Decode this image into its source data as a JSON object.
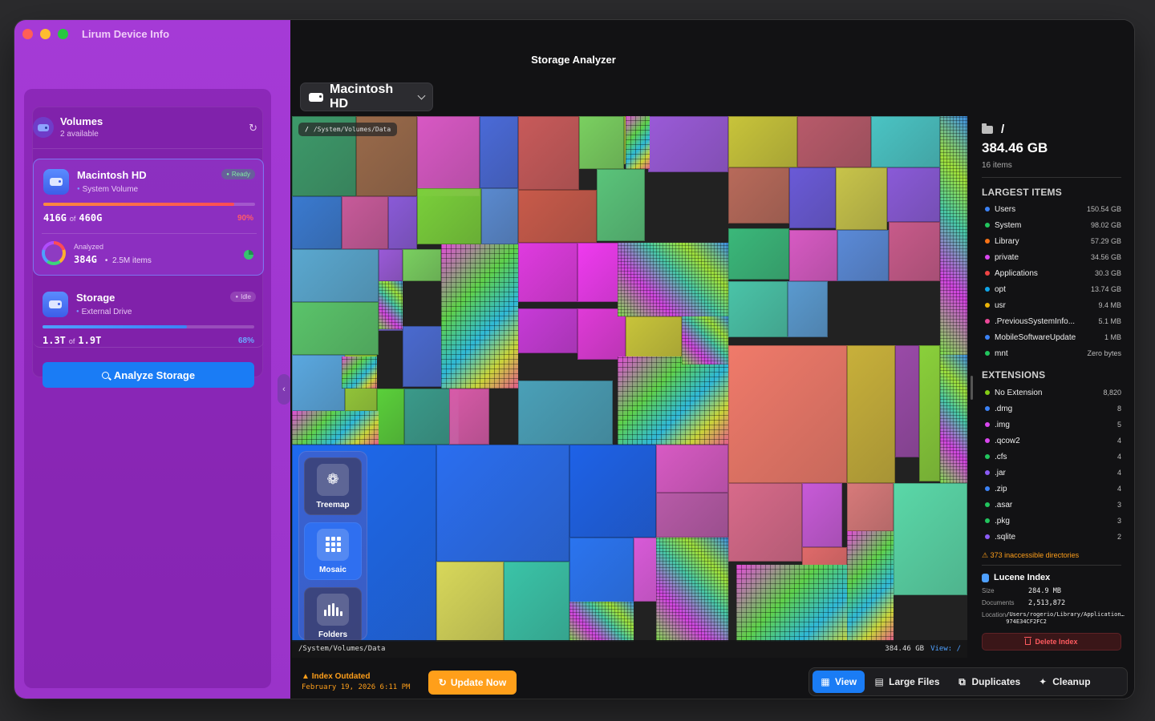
{
  "app": {
    "title": "Lirum Device Info"
  },
  "volumes": {
    "title": "Volumes",
    "subtitle": "2 available",
    "drives": [
      {
        "name": "Macintosh HD",
        "type": "System Volume",
        "status": "Ready",
        "used": "416G",
        "of": "of",
        "total": "460G",
        "percent": "90%",
        "fill_fraction": 0.9,
        "analyzed_label": "Analyzed",
        "analyzed_size": "384G",
        "analyzed_items": "2.5M items"
      },
      {
        "name": "Storage",
        "type": "External Drive",
        "status": "Idle",
        "used": "1.3T",
        "of": "of",
        "total": "1.9T",
        "percent": "68%",
        "fill_fraction": 0.68
      }
    ],
    "analyze_button": "Analyze Storage"
  },
  "main": {
    "title": "Storage Analyzer",
    "selected_volume": "Macintosh HD"
  },
  "treemap": {
    "path_root": "/",
    "path": "/System/Volumes/Data",
    "footer_path": "/System/Volumes/Data",
    "footer_size": "384.46 GB",
    "footer_view": "View: /",
    "modes": [
      {
        "label": "Treemap",
        "icon": "flower-icon",
        "active": false
      },
      {
        "label": "Mosaic",
        "icon": "grid-icon",
        "active": true
      },
      {
        "label": "Folders",
        "icon": "bar-chart-icon",
        "active": false
      }
    ]
  },
  "details": {
    "folder": "/",
    "size": "384.46 GB",
    "item_count": "16 items",
    "largest_title": "LARGEST ITEMS",
    "largest": [
      {
        "name": "Users",
        "value": "150.54 GB",
        "color": "#3b82f6"
      },
      {
        "name": "System",
        "value": "98.02 GB",
        "color": "#22c55e"
      },
      {
        "name": "Library",
        "value": "57.29 GB",
        "color": "#f97316"
      },
      {
        "name": "private",
        "value": "34.56 GB",
        "color": "#d946ef"
      },
      {
        "name": "Applications",
        "value": "30.3 GB",
        "color": "#ef4444"
      },
      {
        "name": "opt",
        "value": "13.74 GB",
        "color": "#0ea5e9"
      },
      {
        "name": "usr",
        "value": "9.4 MB",
        "color": "#eab308"
      },
      {
        "name": ".PreviousSystemInfo...",
        "value": "5.1 MB",
        "color": "#ec4899"
      },
      {
        "name": "MobileSoftwareUpdate",
        "value": "1 MB",
        "color": "#3b82f6"
      },
      {
        "name": "mnt",
        "value": "Zero bytes",
        "color": "#22c55e"
      }
    ],
    "extensions_title": "EXTENSIONS",
    "extensions": [
      {
        "name": "No Extension",
        "value": "8,820",
        "color": "#84cc16"
      },
      {
        "name": ".dmg",
        "value": "8",
        "color": "#3b82f6"
      },
      {
        "name": ".img",
        "value": "5",
        "color": "#d946ef"
      },
      {
        "name": ".qcow2",
        "value": "4",
        "color": "#d946ef"
      },
      {
        "name": ".cfs",
        "value": "4",
        "color": "#22c55e"
      },
      {
        "name": ".jar",
        "value": "4",
        "color": "#8b5cf6"
      },
      {
        "name": ".zip",
        "value": "4",
        "color": "#3b82f6"
      },
      {
        "name": ".asar",
        "value": "3",
        "color": "#22c55e"
      },
      {
        "name": ".pkg",
        "value": "3",
        "color": "#22c55e"
      },
      {
        "name": ".sqlite",
        "value": "2",
        "color": "#8b5cf6"
      }
    ],
    "warning": "373 inaccessible directories",
    "lucene": {
      "title": "Lucene Index",
      "size_label": "Size",
      "size": "284.9 MB",
      "docs_label": "Documents",
      "docs": "2,513,872",
      "location_label": "Location",
      "location": "/Users/rogerio/Library/Application…974E34CF2FC2"
    },
    "delete_button": "Delete Index"
  },
  "status": {
    "title": "Index Outdated",
    "date": "February 19, 2026 6:11 PM",
    "update_button": "Update Now"
  },
  "toolbar": {
    "view": "View",
    "large_files": "Large Files",
    "duplicates": "Duplicates",
    "cleanup": "Cleanup"
  }
}
